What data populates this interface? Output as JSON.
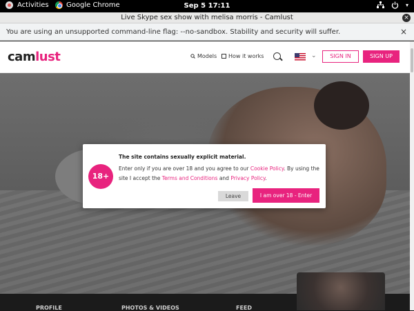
{
  "topbar": {
    "activities": "Activities",
    "app_name": "Google Chrome",
    "clock": "Sep 5  17:11"
  },
  "window": {
    "title": "Live Skype sex show with melisa morris - Camlust",
    "close_glyph": "×"
  },
  "infobar": {
    "message": "You are using an unsupported command-line flag: --no-sandbox. Stability and security will suffer.",
    "close_glyph": "×"
  },
  "site": {
    "logo_part1": "cam",
    "logo_part2": "lust",
    "nav_models": "Models",
    "nav_how": "How it works",
    "sign_in": "SIGN IN",
    "sign_up": "SIGN UP",
    "accent_color": "#e8237e"
  },
  "modal": {
    "badge": "18+",
    "title": "The site contains sexually explicit material.",
    "body_part1": "Enter only if you are over 18 and you agree to our ",
    "cookie_link": "Cookie Policy",
    "body_part2": ". By using the site I accept the ",
    "terms_link": "Terms and Conditions",
    "body_part3": " and ",
    "privacy_link": "Privacy Policy",
    "body_part4": ".",
    "leave": "Leave",
    "enter": "I am over 18 - Enter"
  },
  "footer": {
    "col1": "PROFILE",
    "col2": "PHOTOS & VIDEOS",
    "col3": "FEED"
  }
}
